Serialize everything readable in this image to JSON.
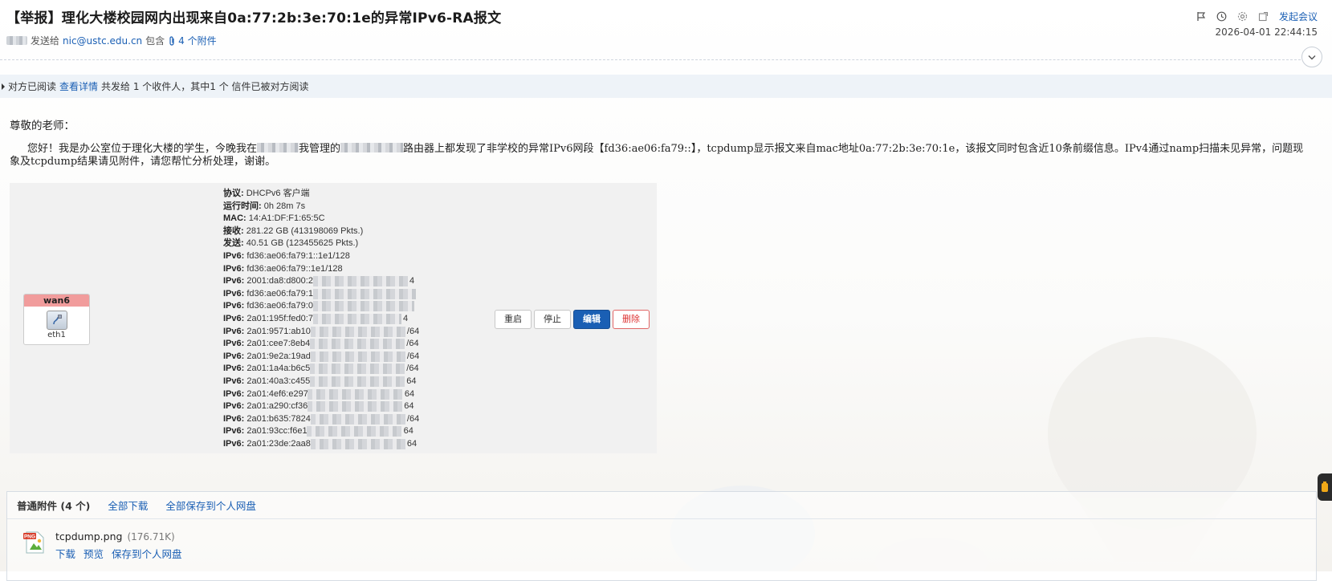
{
  "header": {
    "subject": "【举报】理化大楼校园网内出现来自0a:77:2b:3e:70:1e的异常IPv6-RA报文",
    "sent_to_label": "发送给",
    "recipient": "nic@ustc.edu.cn",
    "contains_label": "包含",
    "attachments_link": "4 个附件",
    "launch_meeting": "发起会议",
    "datetime": "2026-04-01 22:44:15"
  },
  "read_receipt": {
    "text_before": "对方已阅读",
    "details_link": "查看详情",
    "text_after": "共发给 1 个收件人，其中1 个 信件已被对方阅读"
  },
  "body": {
    "greeting": "尊敬的老师：",
    "part1": "您好！我是办公室位于理化大楼的学生，今晚我在",
    "part2": "我管理的",
    "part3": "路由器上都发现了非学校的异常IPv6网段【fd36:ae06:fa79::】，tcpdump显示报文来自mac地址0a:77:2b:3e:70:1e，该报文同时包含近10条前缀信息。IPv4通过namp扫描未见异常，问题现象及tcpdump结果请见附件，请您帮忙分析处理，谢谢。"
  },
  "screenshot": {
    "iface_name": "wan6",
    "iface_device": "eth1",
    "rows": [
      {
        "k": "协议:",
        "v": "DHCPv6 客户端"
      },
      {
        "k": "运行时间:",
        "v": "0h 28m 7s"
      },
      {
        "k": "MAC:",
        "v": "14:A1:DF:F1:65:5C"
      },
      {
        "k": "接收:",
        "v": "281.22 GB (413198069 Pkts.)"
      },
      {
        "k": "发送:",
        "v": "40.51 GB (123455625 Pkts.)"
      },
      {
        "k": "IPv6:",
        "v": "fd36:ae06:fa79:1::1e1/128"
      },
      {
        "k": "IPv6:",
        "v": "fd36:ae06:fa79::1e1/128"
      },
      {
        "k": "IPv6:",
        "v": "2001:da8:d800:2",
        "tail": "4"
      },
      {
        "k": "IPv6:",
        "v": "fd36:ae06:fa79:1",
        "tail": ""
      },
      {
        "k": "IPv6:",
        "v": "fd36:ae06:fa79:0",
        "tail": ""
      },
      {
        "k": "IPv6:",
        "v": "2a01:195f:fed0:7",
        "tail": "4"
      },
      {
        "k": "IPv6:",
        "v": "2a01:9571:ab10",
        "tail": "/64"
      },
      {
        "k": "IPv6:",
        "v": "2a01:cee7:8eb4",
        "tail": "/64"
      },
      {
        "k": "IPv6:",
        "v": "2a01:9e2a:19ad",
        "tail": "/64"
      },
      {
        "k": "IPv6:",
        "v": "2a01:1a4a:b6c5",
        "tail": "/64"
      },
      {
        "k": "IPv6:",
        "v": "2a01:40a3:c455",
        "tail": "64"
      },
      {
        "k": "IPv6:",
        "v": "2a01:4ef6:e297",
        "tail": "64"
      },
      {
        "k": "IPv6:",
        "v": "2a01:a290:cf36",
        "tail": "64"
      },
      {
        "k": "IPv6:",
        "v": "2a01:b635:7824",
        "tail": "/64"
      },
      {
        "k": "IPv6:",
        "v": "2a01:93cc:f6e1",
        "tail": "64"
      },
      {
        "k": "IPv6:",
        "v": "2a01:23de:2aa8",
        "tail": "64"
      }
    ],
    "buttons": {
      "restart": "重启",
      "stop": "停止",
      "edit": "编辑",
      "delete": "删除"
    }
  },
  "attachments": {
    "title": "普通附件 (4 个)",
    "download_all": "全部下载",
    "save_all": "全部保存到个人网盘",
    "items": [
      {
        "name": "tcpdump.png",
        "size": "(176.71K)",
        "icon_badge": "PNG",
        "download": "下载",
        "preview": "预览",
        "save": "保存到个人网盘"
      }
    ]
  },
  "colors": {
    "link": "#1a5fb4",
    "readbar_bg": "#eef3f8",
    "iface_head": "#f19c9c",
    "primary_button": "#1a5fb4"
  },
  "icons": [
    "flag-icon",
    "clock-icon",
    "settings-icon",
    "export-icon",
    "chevron-down-icon",
    "paperclip-icon",
    "network-port-icon",
    "png-file-icon",
    "side-tab-icon"
  ]
}
